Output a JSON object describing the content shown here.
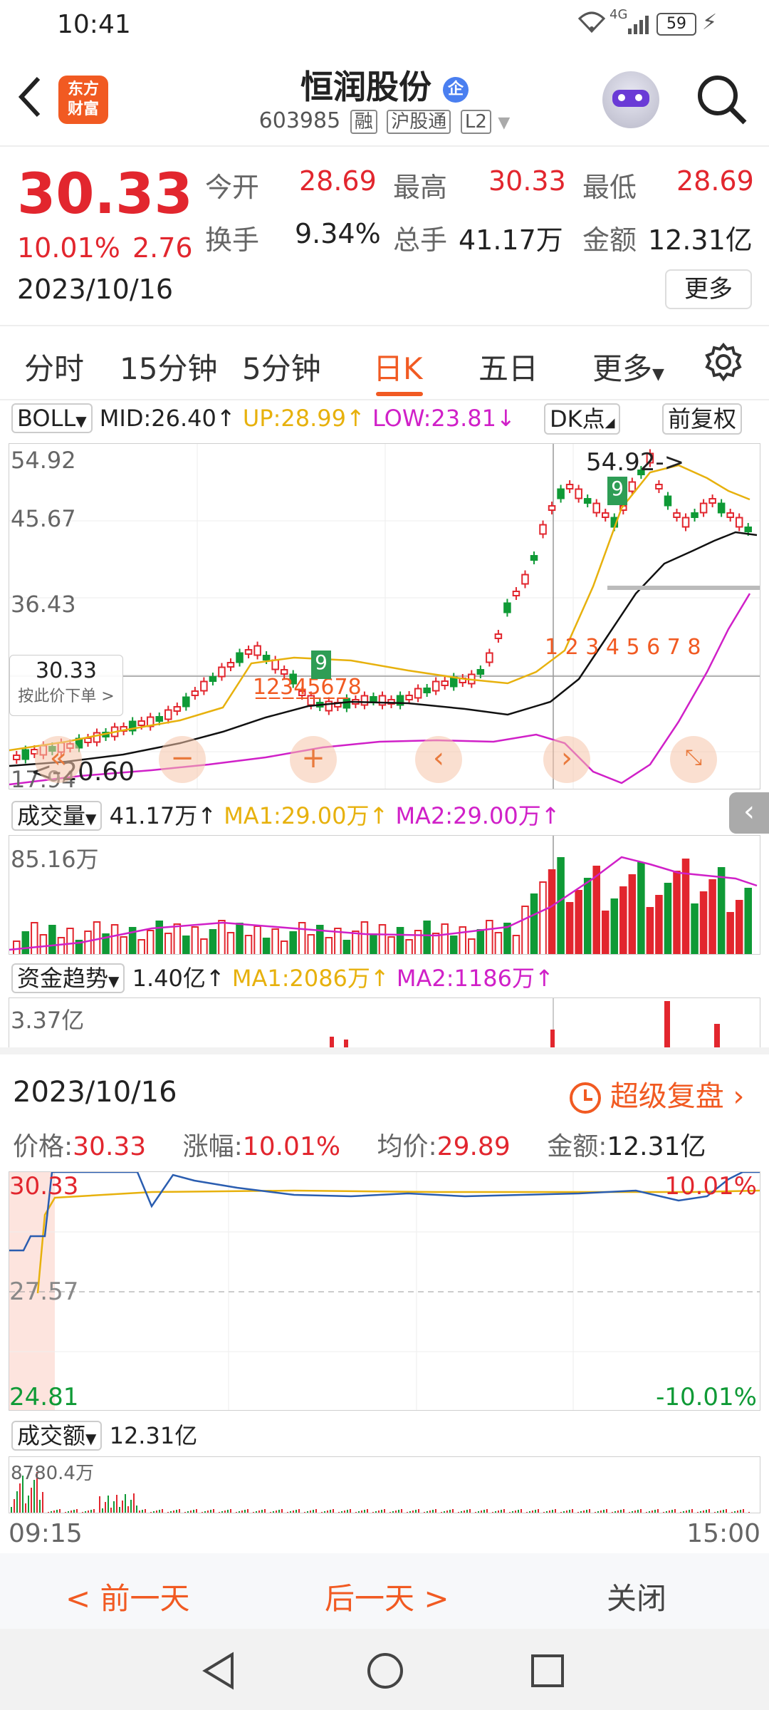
{
  "status": {
    "time": "10:41",
    "battery": "59",
    "net": "4G"
  },
  "header": {
    "logo_line1": "东方",
    "logo_line2": "财富",
    "title": "恒润股份",
    "badge": "企",
    "code": "603985",
    "tags": [
      "融",
      "沪股通",
      "L2"
    ]
  },
  "quote": {
    "price": "30.33",
    "change_pct": "10.01%",
    "change": "2.76",
    "date": "2023/10/16",
    "open_label": "今开",
    "open": "28.69",
    "high_label": "最高",
    "high": "30.33",
    "low_label": "最低",
    "low": "28.69",
    "turnover_label": "换手",
    "turnover": "9.34%",
    "volume_label": "总手",
    "volume": "41.17万",
    "amount_label": "金额",
    "amount": "12.31亿",
    "more": "更多"
  },
  "tabs": [
    "分时",
    "15分钟",
    "5分钟",
    "日K",
    "五日",
    "更多"
  ],
  "active_tab": "日K",
  "boll": {
    "name": "BOLL",
    "mid": "MID:26.40↑",
    "up": "UP:28.99↑",
    "low": "LOW:23.81↓",
    "dk": "DK点",
    "fq": "前复权"
  },
  "kline": {
    "y_top": "54.92",
    "y_mid1": "45.67",
    "y_mid2": "36.43",
    "y_bottom": "17.94",
    "cross_price": "30.33",
    "cross_hint": "按此价下单 >",
    "peak_label": "54.92->",
    "low_label": "<-20.60"
  },
  "volume": {
    "name": "成交量",
    "value": "41.17万↑",
    "ma1": "MA1:29.00万↑",
    "ma2": "MA2:29.00万↑",
    "max": "85.16万"
  },
  "capital": {
    "name": "资金趋势",
    "value": "1.40亿↑",
    "ma1": "MA1:2086万↑",
    "ma2": "MA2:1186万↑",
    "max": "3.37亿"
  },
  "panel": {
    "date": "2023/10/16",
    "replay": "超级复盘",
    "price_label": "价格:",
    "price": "30.33",
    "chg_label": "涨幅:",
    "chg": "10.01%",
    "avg_label": "均价:",
    "avg": "29.89",
    "amt_label": "金额:",
    "amt": "12.31亿",
    "y_high": "30.33",
    "y_mid": "27.57",
    "y_low": "24.81",
    "pct_high": "10.01%",
    "pct_low": "-10.01%",
    "amount_name": "成交额",
    "amount_value": "12.31亿",
    "amount_max": "8780.4万",
    "time_start": "09:15",
    "time_end": "15:00"
  },
  "bottom": {
    "prev": "< 前一天",
    "next": "后一天 >",
    "close": "关闭"
  },
  "colors": {
    "up": "#e2262e",
    "down": "#0f9a36",
    "ma1": "#e7b10d",
    "ma2": "#d020c8",
    "accent": "#f15a22"
  }
}
